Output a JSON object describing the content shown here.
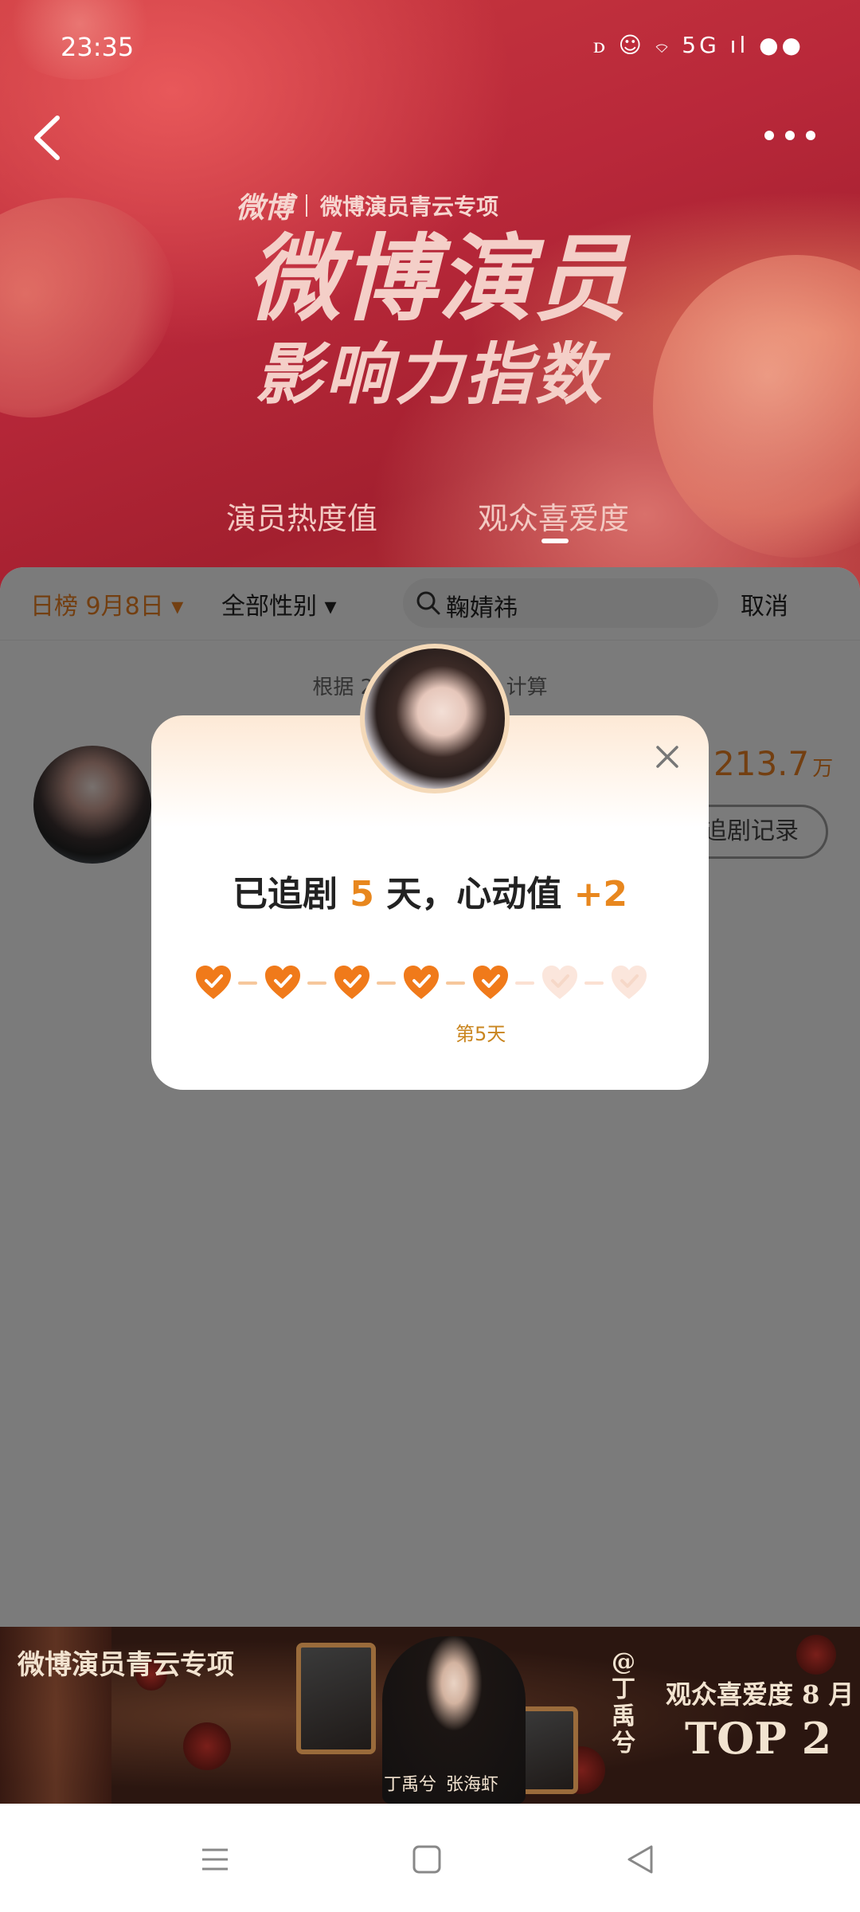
{
  "status_bar": {
    "time": "23:35",
    "icons": "ꭰ ☺ ⌔ 5G ıl ●●"
  },
  "header": {
    "brand_logo": "微博",
    "brand_sub": "微博演员青云专项",
    "title_line1": "微博演员",
    "title_line2": "影响力指数",
    "tabs": [
      {
        "label": "演员热度值",
        "active": false
      },
      {
        "label": "观众喜爱度",
        "active": true
      }
    ]
  },
  "filters": {
    "date": "日榜 9月8日 ▾",
    "gender": "全部性别 ▾",
    "search_value": "鞠婧祎",
    "cancel_label": "取消"
  },
  "list": {
    "notice_left": "根据 2",
    "notice_right": "计算",
    "rows": [
      {
        "score": "213.7",
        "score_unit": "万",
        "record_button": "追剧记录"
      }
    ]
  },
  "popup": {
    "message_prefix": "已追剧",
    "days": "5",
    "message_middle": "天，心动值",
    "points": "+2",
    "hearts": [
      true,
      true,
      true,
      true,
      true,
      false,
      false
    ],
    "current_day_label": "第5天"
  },
  "banner": {
    "title": "微博演员青云专项",
    "handle": "@丁禹兮",
    "rank_label": "观众喜爱度 8 月",
    "rank": "TOP 2",
    "name1": "丁禹兮",
    "name2": "张海虾"
  },
  "colors": {
    "accent": "#e8871e",
    "hero_red": "#b9283a",
    "heart_filled": "#f07a1a",
    "heart_empty": "#fbe6dc"
  }
}
